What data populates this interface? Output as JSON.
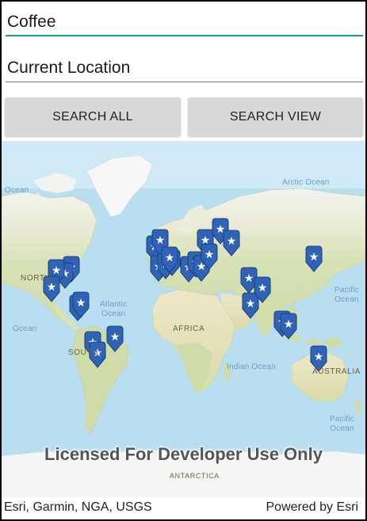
{
  "search": {
    "query": "Coffee",
    "location": "Current Location"
  },
  "buttons": {
    "search_all": "SEARCH ALL",
    "search_view": "SEARCH VIEW"
  },
  "map": {
    "labels": {
      "ocean_w": "Ocean",
      "arctic": "Arctic Ocean",
      "north": "NORTH",
      "atlantic": "Atlantic\nOcean",
      "pacific_ne": "Pacific\nOcean",
      "ocean_sw": "Ocean",
      "africa": "AFRICA",
      "south": "SOUTH",
      "indian": "Indian Ocean",
      "australia": "AUSTRALIA",
      "pacific_se": "Pacific\nOcean",
      "antarctica": "ANTARCTICA"
    },
    "watermark": "Licensed For Developer Use Only",
    "marker_color": "#2e63b5",
    "marker_icon": "star-map-pin-icon"
  },
  "attribution": {
    "left": "Esri, Garmin, NGA, USGS",
    "right": "Powered by Esri"
  }
}
